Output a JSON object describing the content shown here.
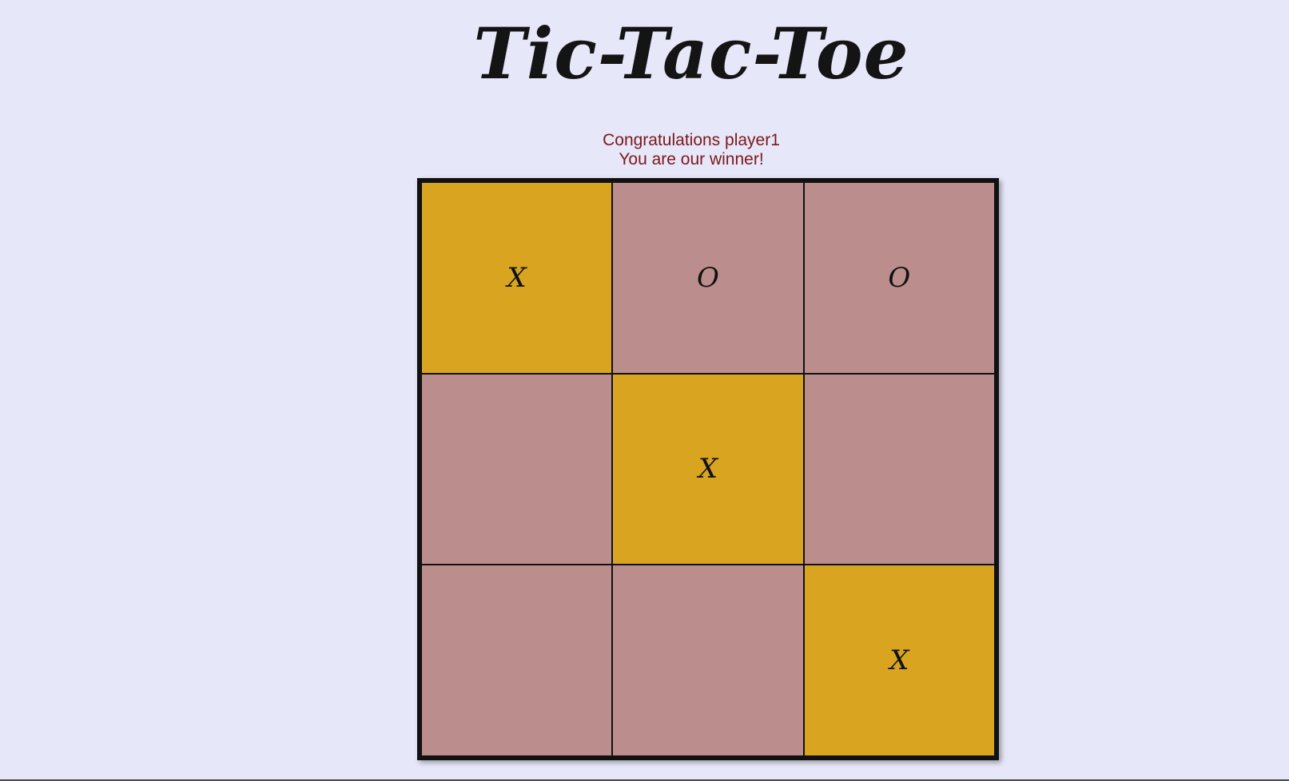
{
  "title": "Tic-Tac-Toe",
  "message": {
    "line1": "Congratulations player1",
    "line2": "You are our winner!"
  },
  "colors": {
    "background": "#e6e7f9",
    "cell": "#bb8e8d",
    "winning_cell": "#d9a521",
    "message": "#7d1818"
  },
  "board": {
    "cells": [
      {
        "mark": "X",
        "winning": true
      },
      {
        "mark": "O",
        "winning": false
      },
      {
        "mark": "O",
        "winning": false
      },
      {
        "mark": "",
        "winning": false
      },
      {
        "mark": "X",
        "winning": true
      },
      {
        "mark": "",
        "winning": false
      },
      {
        "mark": "",
        "winning": false
      },
      {
        "mark": "",
        "winning": false
      },
      {
        "mark": "X",
        "winning": true
      }
    ]
  }
}
